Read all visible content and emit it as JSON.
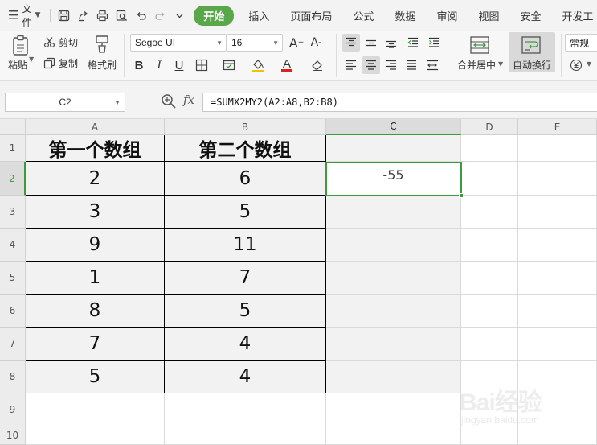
{
  "menubar": {
    "file_label": "文件",
    "tabs": [
      "开始",
      "插入",
      "页面布局",
      "公式",
      "数据",
      "审阅",
      "视图",
      "安全",
      "开发工"
    ],
    "active_tab_index": 0
  },
  "ribbon": {
    "paste": "粘贴",
    "cut": "剪切",
    "copy": "复制",
    "format_painter": "格式刷",
    "font_name": "Segoe UI",
    "font_size": "16",
    "merge_center": "合并居中",
    "wrap_text": "自动换行",
    "number_format": "常规"
  },
  "formula_bar": {
    "cell_ref": "C2",
    "fx": "fx",
    "formula": "=SUMX2MY2(A2:A8,B2:B8)"
  },
  "grid": {
    "columns": [
      "A",
      "B",
      "C",
      "D",
      "E"
    ],
    "rows": [
      "1",
      "2",
      "3",
      "4",
      "5",
      "6",
      "7",
      "8",
      "9",
      "10"
    ],
    "headers": {
      "a": "第一个数组",
      "b": "第二个数组"
    },
    "data": [
      [
        "2",
        "6"
      ],
      [
        "3",
        "5"
      ],
      [
        "9",
        "11"
      ],
      [
        "1",
        "7"
      ],
      [
        "8",
        "5"
      ],
      [
        "7",
        "4"
      ],
      [
        "5",
        "4"
      ]
    ],
    "result": "-55",
    "selected_cell": "C2"
  },
  "watermark": {
    "brand": "Bai经验",
    "url": "jingyan.baidu.com"
  },
  "colors": {
    "accent_green": "#3f9a3f",
    "tab_green": "#5aa64a",
    "shade": "#f2f2f2"
  }
}
